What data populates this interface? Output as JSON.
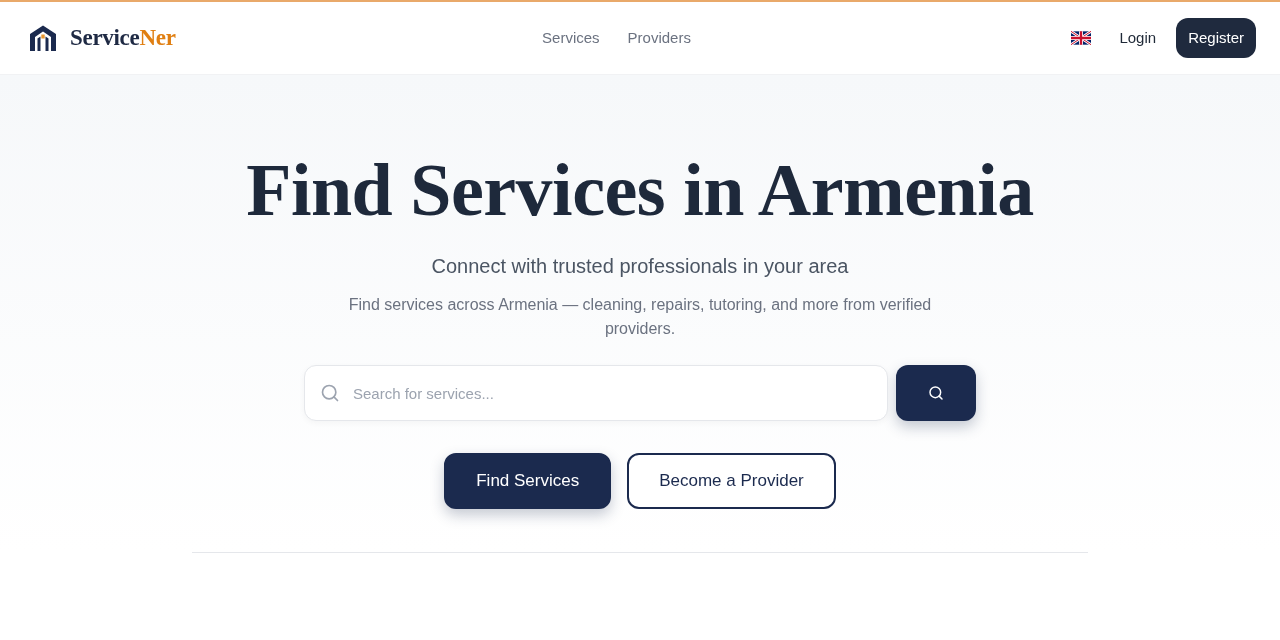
{
  "header": {
    "logo": {
      "text": "Service",
      "accent": "Ner"
    },
    "nav": [
      {
        "label": "Services"
      },
      {
        "label": "Providers"
      }
    ],
    "login": "Login",
    "register": "Register"
  },
  "hero": {
    "title": "Find Services in Armenia",
    "subtitle": "Connect with trusted professionals in your area",
    "description": "Find services across Armenia — cleaning, repairs, tutoring, and more from verified providers.",
    "search": {
      "placeholder": "Search for services..."
    },
    "buttons": [
      {
        "label": "Find Services",
        "kind": "primary"
      },
      {
        "label": "Become a Provider",
        "kind": "outline"
      }
    ]
  }
}
